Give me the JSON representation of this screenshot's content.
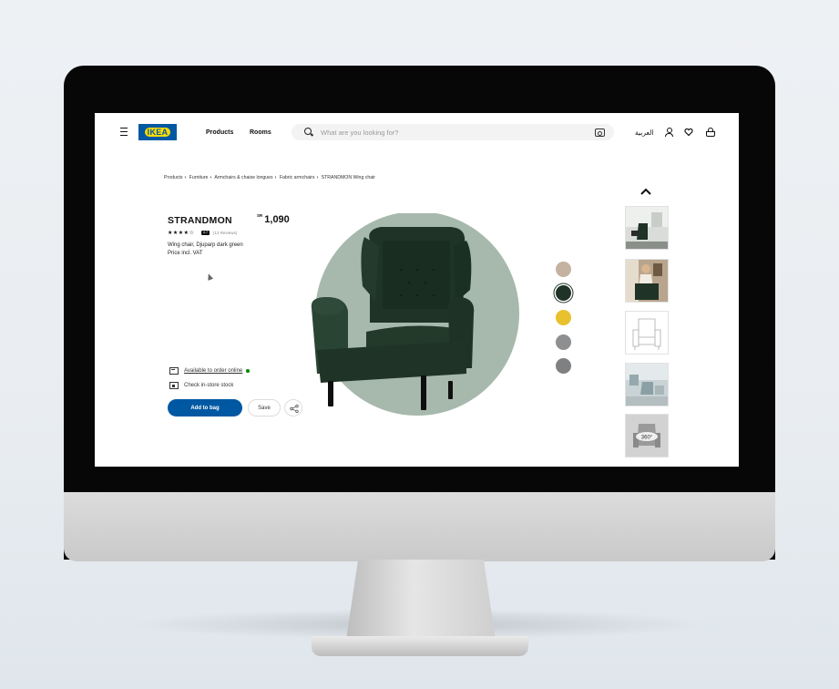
{
  "header": {
    "logo_text": "IKEA",
    "nav": [
      "Products",
      "Rooms"
    ],
    "search_placeholder": "What are you looking for?",
    "language": "العربية"
  },
  "breadcrumb": [
    "Products",
    "Furniture",
    "Armchairs & chaise longues",
    "Fabric armchairs",
    "STRANDMON Wing chair"
  ],
  "product": {
    "name": "STRANDMON",
    "currency": "SR",
    "price": "1,090",
    "rating_stars": "★★★★☆",
    "rating_value": "4.7",
    "reviews": "(13 Reviews)",
    "description": "Wing chair, Djuparp dark green",
    "price_note": "Price incl. VAT"
  },
  "availability": {
    "online": "Available to order online",
    "store": "Check in-store stock"
  },
  "actions": {
    "add_to_bag": "Add to bag",
    "save": "Save"
  },
  "colors": {
    "brand_blue": "#0058a3",
    "brand_yellow": "#ffdb00",
    "hero_circle": "#a6b9ac",
    "chair_green": "#1f3326",
    "swatches": [
      "#c4b3a0",
      "#1f3326",
      "#e9c02e",
      "#8e8f91",
      "#7f8082"
    ]
  },
  "thumbnails": {
    "label_360": "360°"
  }
}
